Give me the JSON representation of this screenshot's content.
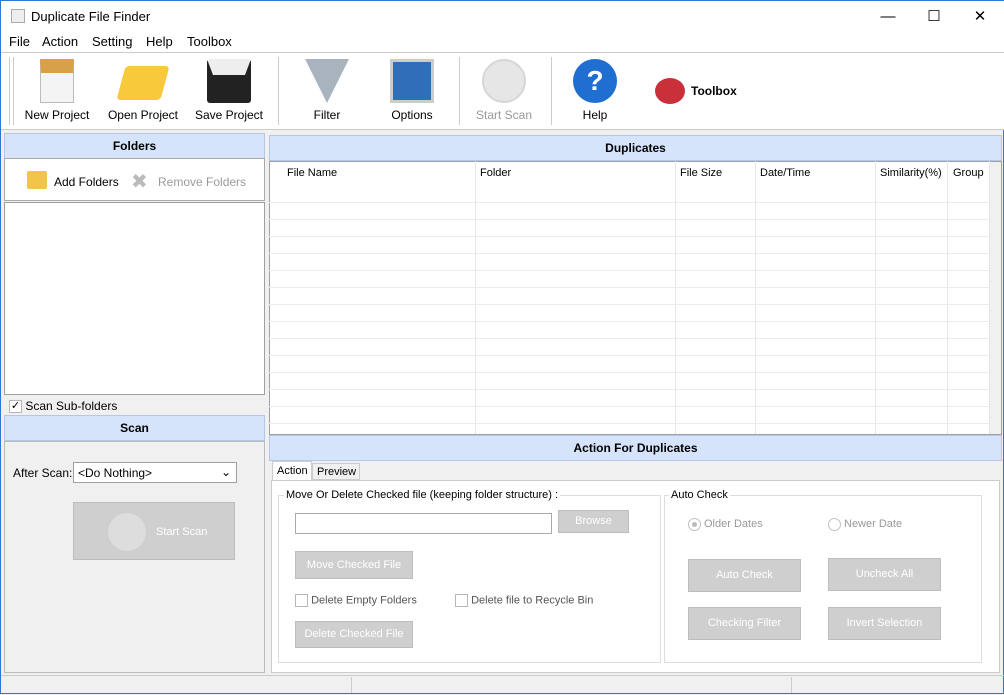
{
  "window": {
    "title": "Duplicate File Finder",
    "minimize": "—",
    "maximize": "☐",
    "close": "✕"
  },
  "menu": [
    "File",
    "Action",
    "Setting",
    "Help",
    "Toolbox"
  ],
  "toolbar": {
    "new_project": "New Project",
    "open_project": "Open Project",
    "save_project": "Save Project",
    "filter": "Filter",
    "options": "Options",
    "start_scan": "Start Scan",
    "help": "Help",
    "toolbox": "Toolbox"
  },
  "folders": {
    "title": "Folders",
    "add": "Add Folders",
    "remove": "Remove Folders",
    "scan_subfolders": "Scan Sub-folders",
    "scan_subfolders_checked": true
  },
  "scan": {
    "title": "Scan",
    "after_scan_label": "After Scan:",
    "after_scan_value": "<Do Nothing>",
    "start_scan": "Start Scan"
  },
  "duplicates": {
    "title": "Duplicates",
    "columns": [
      "File Name",
      "Folder",
      "File Size",
      "Date/Time",
      "Similarity(%)",
      "Group"
    ]
  },
  "action": {
    "title": "Action For Duplicates",
    "tabs": [
      "Action",
      "Preview"
    ],
    "move_group": "Move Or Delete Checked file (keeping folder structure) :",
    "path_value": "",
    "browse": "Browse",
    "move": "Move Checked File",
    "delete_empty": "Delete Empty Folders",
    "recycle": "Delete file to Recycle Bin",
    "delete_checked": "Delete Checked File",
    "auto_group": "Auto Check",
    "older": "Older Dates",
    "newer": "Newer Date",
    "auto_check": "Auto Check",
    "uncheck_all": "Uncheck All",
    "checking_filter": "Checking Filter",
    "invert": "Invert Selection"
  }
}
